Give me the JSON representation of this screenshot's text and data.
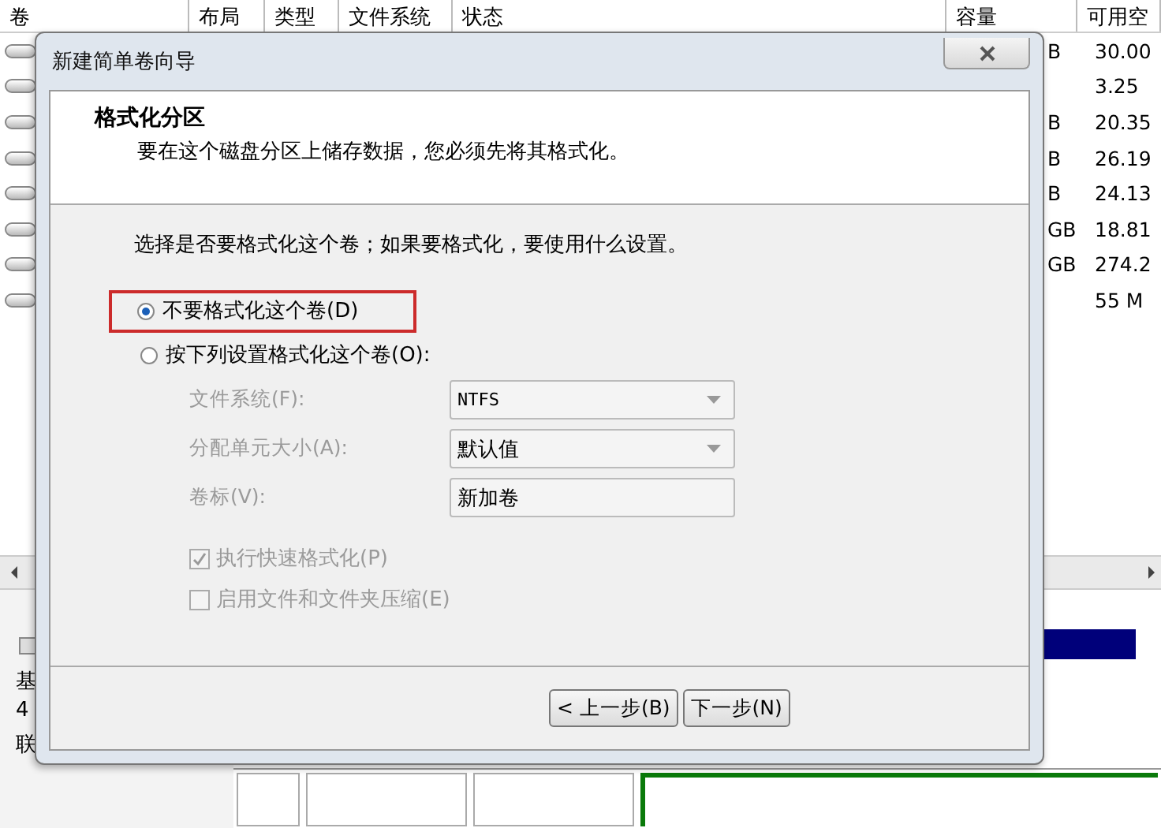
{
  "volume_table": {
    "columns": [
      "卷",
      "布局",
      "类型",
      "文件系统",
      "状态",
      "容量",
      "可用空"
    ],
    "rows": [
      {
        "capacity": "B",
        "free": "30.00"
      },
      {
        "capacity": "",
        "free": "3.25"
      },
      {
        "capacity": "B",
        "free": "20.35"
      },
      {
        "capacity": "B",
        "free": "26.19"
      },
      {
        "capacity": "B",
        "free": "24.13"
      },
      {
        "capacity": "GB",
        "free": "18.81"
      },
      {
        "capacity": "GB",
        "free": "274.2"
      },
      {
        "capacity": "",
        "free": "55 M"
      }
    ]
  },
  "disk_panel": {
    "labels": [
      "基",
      "4",
      "联"
    ]
  },
  "dialog": {
    "title": "新建简单卷向导",
    "heading": "格式化分区",
    "subheading": "要在这个磁盘分区上储存数据，您必须先将其格式化。",
    "prompt": "选择是否要格式化这个卷；如果要格式化，要使用什么设置。",
    "options": [
      {
        "label": "不要格式化这个卷(D)",
        "selected": true,
        "highlighted": true
      },
      {
        "label": "按下列设置格式化这个卷(O):",
        "selected": false,
        "highlighted": false
      }
    ],
    "fields": [
      {
        "kind": "dropdown",
        "label": "文件系统(F):",
        "value": "NTFS",
        "disabled": true
      },
      {
        "kind": "dropdown",
        "label": "分配单元大小(A):",
        "value": "默认值",
        "disabled": true
      },
      {
        "kind": "text",
        "label": "卷标(V):",
        "value": "新加卷",
        "disabled": true
      }
    ],
    "checkboxes": [
      {
        "label": "执行快速格式化(P)",
        "checked": true,
        "disabled": true
      },
      {
        "label": "启用文件和文件夹压缩(E)",
        "checked": false,
        "disabled": true
      }
    ],
    "buttons": [
      "< 上一步(B)",
      "下一步(N)"
    ]
  }
}
